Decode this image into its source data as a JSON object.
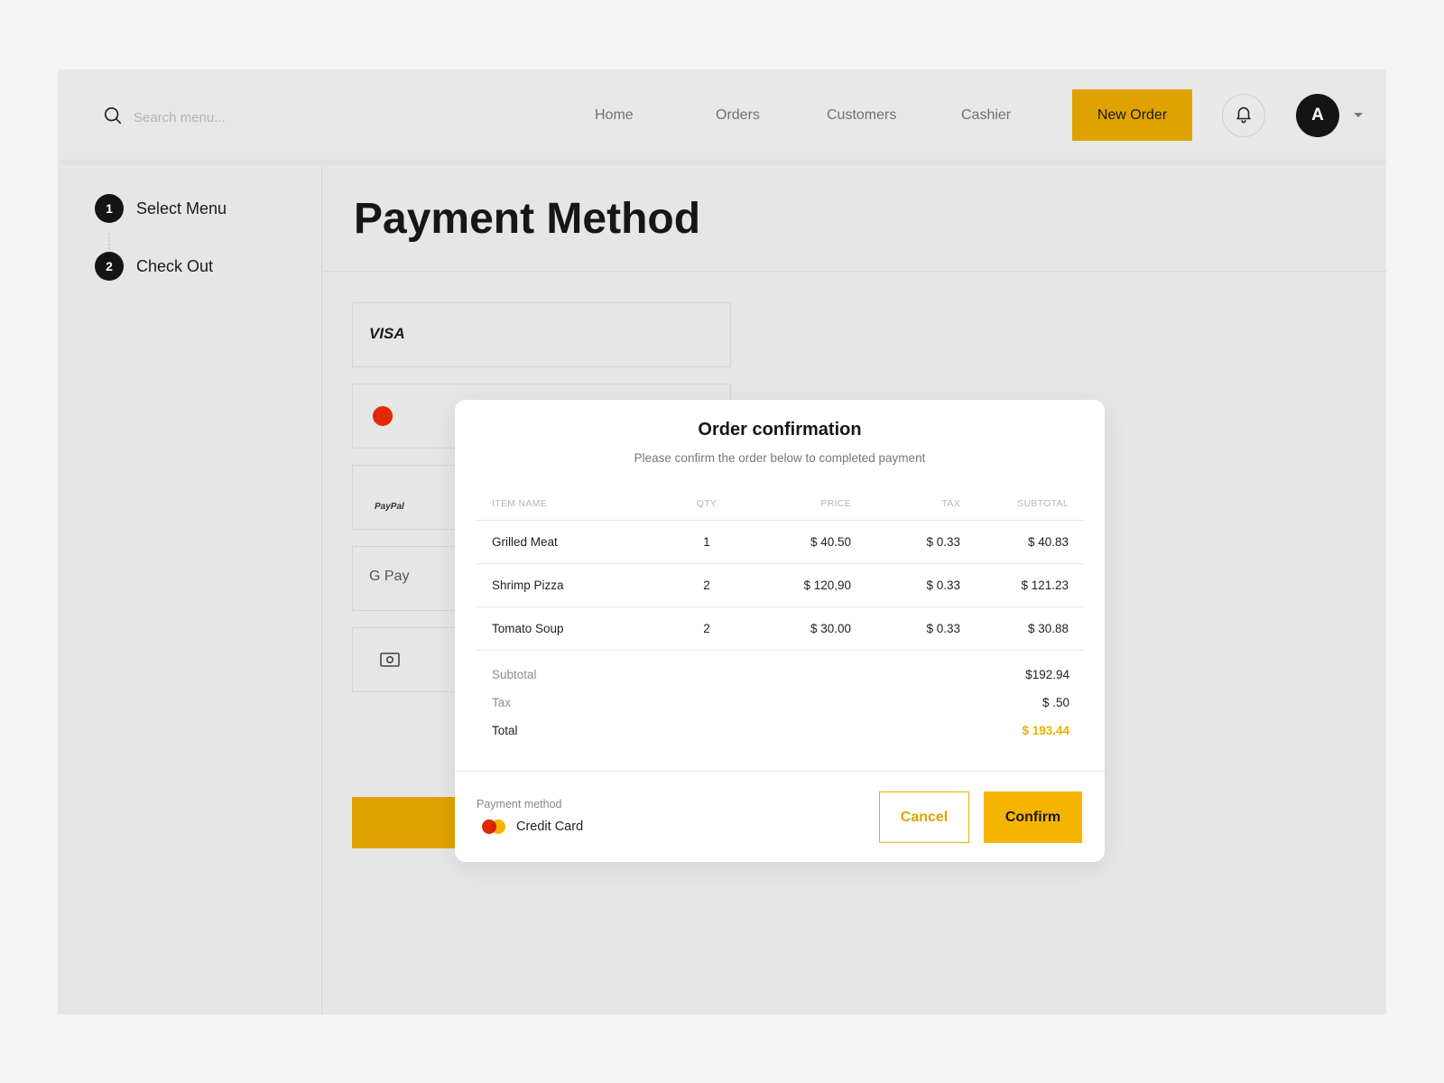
{
  "search": {
    "placeholder": "Search menu..."
  },
  "nav": {
    "items": [
      {
        "label": "Home"
      },
      {
        "label": "Orders"
      },
      {
        "label": "Customers"
      },
      {
        "label": "Cashier"
      }
    ],
    "new_order_label": "New Order"
  },
  "user": {
    "avatar_initial": "A"
  },
  "steps": [
    {
      "number": "1",
      "label": "Select Menu"
    },
    {
      "number": "2",
      "label": "Check Out"
    }
  ],
  "page": {
    "title": "Payment Method"
  },
  "payment_options": [
    {
      "label": "VISA",
      "icon": "visa-logo"
    },
    {
      "label": "",
      "icon": "mastercard-logo"
    },
    {
      "label": "PayPal",
      "icon": "paypal-logo"
    },
    {
      "label": "G Pay",
      "icon": "google-pay-logo"
    },
    {
      "label": "",
      "icon": "cash-icon"
    }
  ],
  "modal": {
    "title": "Order confirmation",
    "subtitle": "Please confirm the order below to completed payment",
    "columns": {
      "name": "ITEM NAME",
      "qty": "QTY",
      "price": "PRICE",
      "tax": "TAX",
      "subtotal": "SUBTOTAL"
    },
    "items": [
      {
        "name": "Grilled Meat",
        "qty": "1",
        "price": "$ 40.50",
        "tax": "$ 0.33",
        "subtotal": "$ 40.83"
      },
      {
        "name": "Shrimp Pizza",
        "qty": "2",
        "price": "$ 120,90",
        "tax": "$ 0.33",
        "subtotal": "$ 121.23"
      },
      {
        "name": "Tomato Soup",
        "qty": "2",
        "price": "$ 30.00",
        "tax": "$ 0.33",
        "subtotal": "$ 30.88"
      }
    ],
    "summary": {
      "subtotal_label": "Subtotal",
      "subtotal_value": "$192.94",
      "tax_label": "Tax",
      "tax_value": "$ .50",
      "total_label": "Total",
      "total_value": "$ 193.44"
    },
    "payment_method_label": "Payment method",
    "payment_method_value": "Credit Card",
    "cancel_label": "Cancel",
    "confirm_label": "Confirm"
  },
  "colors": {
    "accent": "#e0a200",
    "accent_bright": "#f5b400",
    "dark": "#141414"
  }
}
